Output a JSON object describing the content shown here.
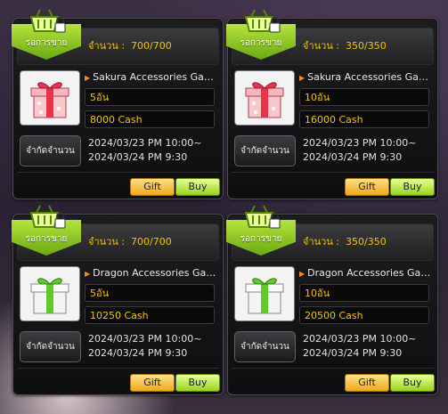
{
  "cards": [
    {
      "badge_label": "รอการขาย",
      "quantity_label": "จำนวน :  700/700",
      "title": "Sakura Accessories Gac...",
      "amount": "5อัน",
      "price": "8000 Cash",
      "limit_button": "จำกัดจำนวน",
      "start": "2024/03/23 PM 10:00~",
      "end": "2024/03/24 PM 9:30",
      "gift_label": "Gift",
      "buy_label": "Buy",
      "gift_icon": "pink-gift-box-icon"
    },
    {
      "badge_label": "รอการขาย",
      "quantity_label": "จำนวน :  350/350",
      "title": "Sakura Accessories Gac...",
      "amount": "10อัน",
      "price": "16000 Cash",
      "limit_button": "จำกัดจำนวน",
      "start": "2024/03/23 PM 10:00~",
      "end": "2024/03/24 PM 9:30",
      "gift_label": "Gift",
      "buy_label": "Buy",
      "gift_icon": "pink-gift-box-icon"
    },
    {
      "badge_label": "รอการขาย",
      "quantity_label": "จำนวน :  700/700",
      "title": "Dragon Accessories Gac...",
      "amount": "5อัน",
      "price": "10250 Cash",
      "limit_button": "จำกัดจำนวน",
      "start": "2024/03/23 PM 10:00~",
      "end": "2024/03/24 PM 9:30",
      "gift_label": "Gift",
      "buy_label": "Buy",
      "gift_icon": "green-gift-box-icon"
    },
    {
      "badge_label": "รอการขาย",
      "quantity_label": "จำนวน :  350/350",
      "title": "Dragon Accessories Gac...",
      "amount": "10อัน",
      "price": "20500 Cash",
      "limit_button": "จำกัดจำนวน",
      "start": "2024/03/23 PM 10:00~",
      "end": "2024/03/24 PM 9:30",
      "gift_label": "Gift",
      "buy_label": "Buy",
      "gift_icon": "green-gift-box-icon"
    }
  ],
  "colors": {
    "accent_gold": "#f2c200",
    "badge_green": "#8cc82a",
    "gift_pink": "#e85a6a",
    "gift_green": "#5ccc2a"
  }
}
